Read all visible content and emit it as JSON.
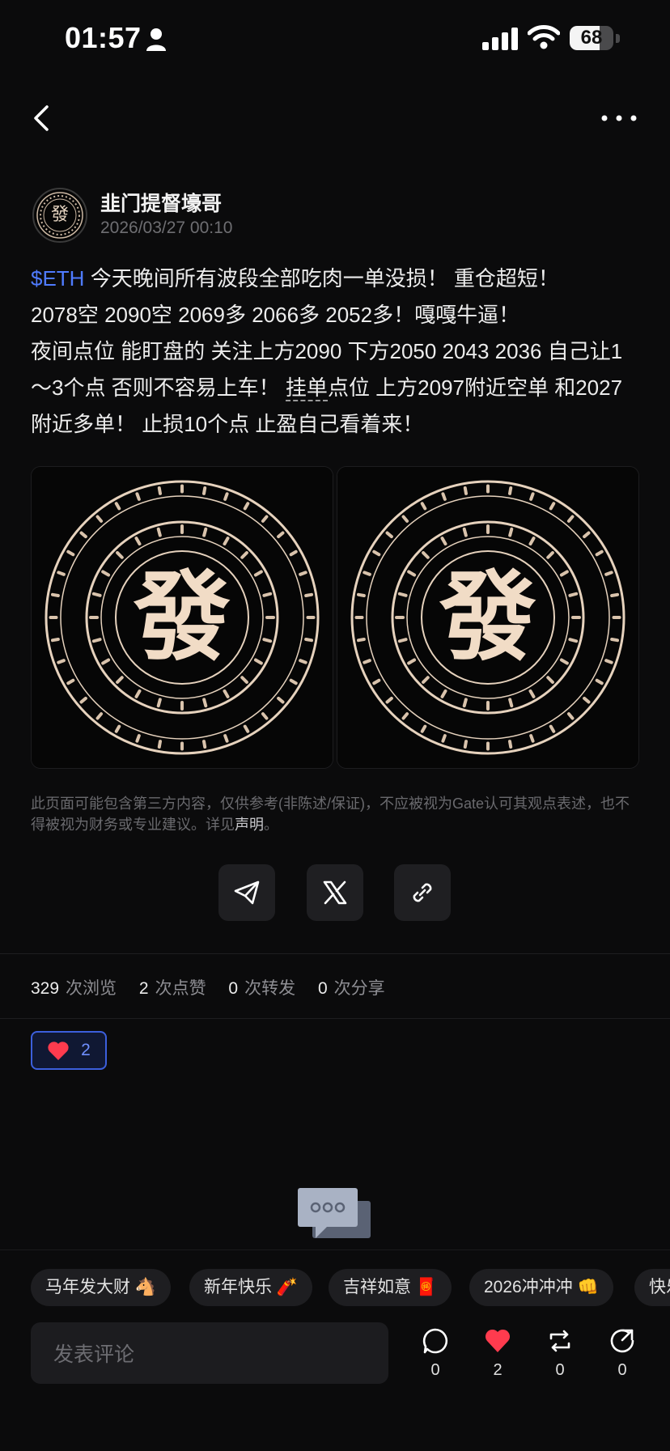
{
  "status_bar": {
    "time": "01:57",
    "battery": "68",
    "battery_level": 0.68
  },
  "author": {
    "name": "韭门提督壕哥",
    "time": "2026/03/27 00:10"
  },
  "post": {
    "ticker": "$ETH",
    "line1": " 今天晚间所有波段全部吃肉一单没损！ 重仓超短！",
    "line2": "2078空 2090空 2069多 2066多 2052多！嘎嘎牛逼！",
    "line3a": "夜间点位 能盯盘的 关注上方2090 下方2050 2043 2036 自己让1～3个点 否则不容易上车！ ",
    "line3_dotted": "挂单",
    "line3b": "点位 上方2097附近空单 和2027附近多单！ 止损10个点 止盈自己看着来！"
  },
  "images": [
    {
      "name": "fortune-seal-image",
      "center_char": "發"
    },
    {
      "name": "fortune-seal-image",
      "center_char": "發"
    }
  ],
  "disclaimer": {
    "text": "此页面可能包含第三方内容，仅供参考(非陈述/保证)，不应被视为Gate认可其观点表述，也不得被视为财务或专业建议。详见",
    "link": "声明",
    "end": "。"
  },
  "share": [
    "telegram-icon",
    "x-icon",
    "link-icon"
  ],
  "stats": [
    {
      "value": "329",
      "label": "次浏览"
    },
    {
      "value": "2",
      "label": "次点赞"
    },
    {
      "value": "0",
      "label": "次转发"
    },
    {
      "value": "0",
      "label": "次分享"
    }
  ],
  "reaction": {
    "icon": "heart-icon",
    "count": "2"
  },
  "tags": [
    "马年发大财 🐴",
    "新年快乐 🧨",
    "吉祥如意 🧧",
    "2026冲冲冲 👊",
    "快乐"
  ],
  "comment": {
    "placeholder": "发表评论"
  },
  "actions": [
    {
      "icon": "comment-icon",
      "count": "0"
    },
    {
      "icon": "heart-icon",
      "count": "2"
    },
    {
      "icon": "repost-icon",
      "count": "0"
    },
    {
      "icon": "share-icon",
      "count": "0"
    }
  ],
  "colors": {
    "accent": "#4f7bff",
    "like": "#ff3b4e",
    "background": "#0b0b0c"
  }
}
